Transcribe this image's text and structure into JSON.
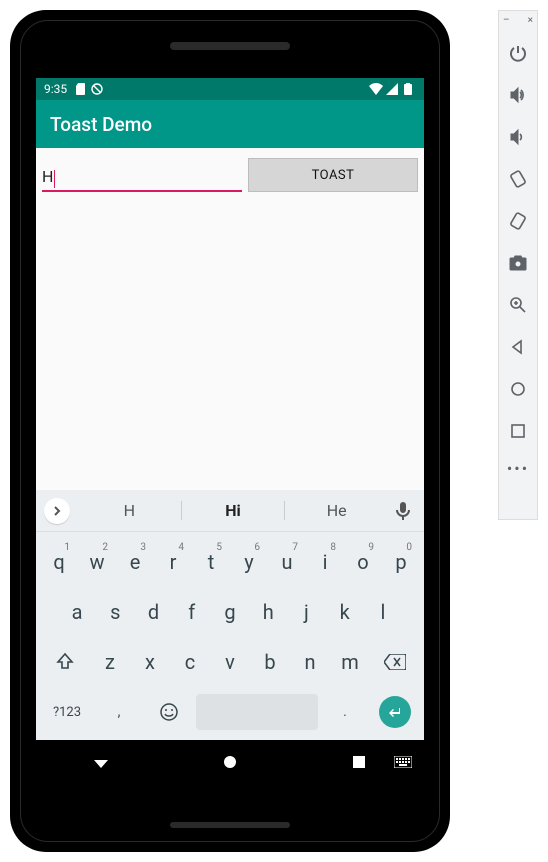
{
  "status": {
    "time": "9:35"
  },
  "actionbar": {
    "title": "Toast Demo"
  },
  "input": {
    "value": "H"
  },
  "button": {
    "label": "TOAST"
  },
  "keyboard": {
    "suggestions": [
      "H",
      "Hi",
      "He"
    ],
    "row1": [
      {
        "k": "q",
        "n": "1"
      },
      {
        "k": "w",
        "n": "2"
      },
      {
        "k": "e",
        "n": "3"
      },
      {
        "k": "r",
        "n": "4"
      },
      {
        "k": "t",
        "n": "5"
      },
      {
        "k": "y",
        "n": "6"
      },
      {
        "k": "u",
        "n": "7"
      },
      {
        "k": "i",
        "n": "8"
      },
      {
        "k": "o",
        "n": "9"
      },
      {
        "k": "p",
        "n": "0"
      }
    ],
    "row2": [
      "a",
      "s",
      "d",
      "f",
      "g",
      "h",
      "j",
      "k",
      "l"
    ],
    "row3": [
      "z",
      "x",
      "c",
      "v",
      "b",
      "n",
      "m"
    ],
    "symbols_label": "?123",
    "comma": ",",
    "period": "."
  },
  "emulator": {
    "minimize": "–",
    "close": "×"
  }
}
